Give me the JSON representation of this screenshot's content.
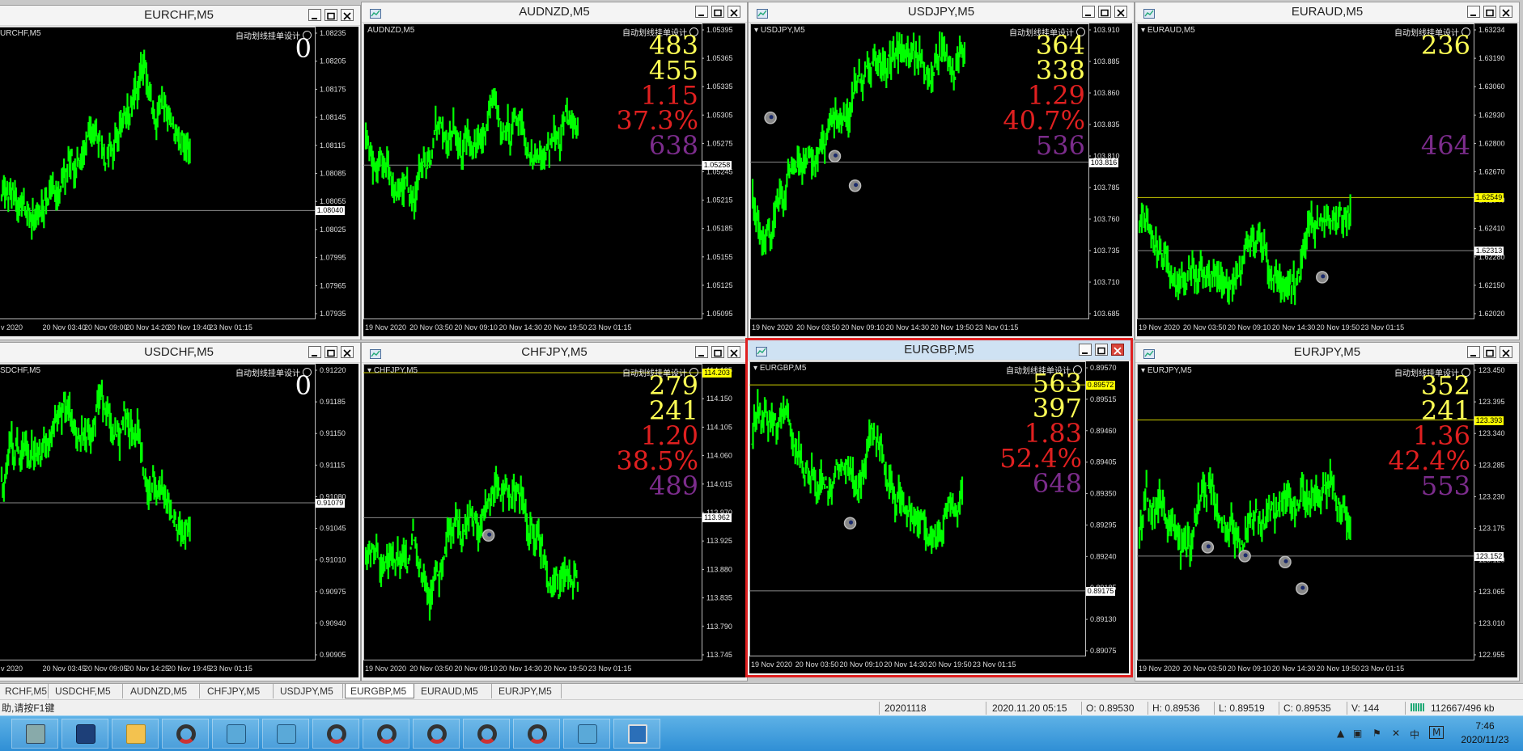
{
  "windows": [
    {
      "title": "EURCHF,M5",
      "label": "URCHF,M5",
      "ea": "自动划线挂单设计",
      "stats": [
        "0"
      ],
      "statColors": [
        "#ffffff"
      ],
      "ylabels": [
        "1.08235",
        "1.08205",
        "1.08175",
        "1.08145",
        "1.08115",
        "1.08085",
        "1.08055",
        "1.08025",
        "1.07995",
        "1.07965",
        "1.07935"
      ],
      "xlabels": [
        "v 2020",
        "20 Nov 03:40",
        "20 Nov 09:00",
        "20 Nov 14:20",
        "20 Nov 19:40",
        "23 Nov 01:15"
      ],
      "priceTags": [
        {
          "text": "1.08040",
          "color": "white"
        }
      ],
      "hasIcon": false,
      "active": false
    },
    {
      "title": "AUDNZD,M5",
      "label": "AUDNZD,M5",
      "ea": "自动划线挂单设计",
      "stats": [
        "483",
        "455",
        "1.15",
        "37.3%",
        "638"
      ],
      "statColors": [
        "#ffff55",
        "#ffff55",
        "#e02020",
        "#e02020",
        "#7c2c8c"
      ],
      "ylabels": [
        "1.05395",
        "1.05365",
        "1.05335",
        "1.05305",
        "1.05275",
        "1.05245",
        "1.05215",
        "1.05185",
        "1.05155",
        "1.05125",
        "1.05095"
      ],
      "xlabels": [
        "19 Nov 2020",
        "20 Nov 03:50",
        "20 Nov 09:10",
        "20 Nov 14:30",
        "20 Nov 19:50",
        "23 Nov 01:15"
      ],
      "priceTags": [
        {
          "text": "1.05258",
          "color": "white"
        }
      ],
      "hasIcon": true,
      "active": false
    },
    {
      "title": "USDJPY,M5",
      "label": "USDJPY,M5",
      "ea": "自动划线挂单设计",
      "stats": [
        "364",
        "338",
        "1.29",
        "40.7%",
        "536"
      ],
      "statColors": [
        "#ffff55",
        "#ffff55",
        "#e02020",
        "#e02020",
        "#7c2c8c"
      ],
      "ylabels": [
        "103.910",
        "103.885",
        "103.860",
        "103.835",
        "103.810",
        "103.785",
        "103.760",
        "103.735",
        "103.710",
        "103.685"
      ],
      "xlabels": [
        "19 Nov 2020",
        "20 Nov 03:50",
        "20 Nov 09:10",
        "20 Nov 14:30",
        "20 Nov 19:50",
        "23 Nov 01:15"
      ],
      "priceTags": [
        {
          "text": "103.816",
          "color": "white"
        }
      ],
      "hasIcon": true,
      "active": false
    },
    {
      "title": "EURAUD,M5",
      "label": "EURAUD,M5",
      "ea": "自动划线挂单设计",
      "stats": [
        "236",
        "",
        "",
        "",
        "464"
      ],
      "statColors": [
        "#ffff55",
        "#ffff55",
        "#e02020",
        "#e02020",
        "#7c2c8c"
      ],
      "ylabels": [
        "1.63234",
        "1.63190",
        "1.63060",
        "1.62930",
        "1.62800",
        "1.62670",
        "1.62540",
        "1.62410",
        "1.62280",
        "1.62150",
        "1.62020"
      ],
      "xlabels": [
        "19 Nov 2020",
        "20 Nov 03:50",
        "20 Nov 09:10",
        "20 Nov 14:30",
        "20 Nov 19:50",
        "23 Nov 01:15"
      ],
      "priceTags": [
        {
          "text": "1.62549",
          "color": "yellow"
        },
        {
          "text": "1.62313",
          "color": "white"
        }
      ],
      "hasIcon": true,
      "active": false
    },
    {
      "title": "USDCHF,M5",
      "label": "SDCHF,M5",
      "ea": "自动划线挂单设计",
      "stats": [
        "0"
      ],
      "statColors": [
        "#ffffff"
      ],
      "ylabels": [
        "0.91220",
        "0.91185",
        "0.91150",
        "0.91115",
        "0.91080",
        "0.91045",
        "0.91010",
        "0.90975",
        "0.90940",
        "0.90905"
      ],
      "xlabels": [
        "v 2020",
        "20 Nov 03:45",
        "20 Nov 09:05",
        "20 Nov 14:25",
        "20 Nov 19:45",
        "23 Nov 01:15"
      ],
      "priceTags": [
        {
          "text": "0.91079",
          "color": "white"
        }
      ],
      "hasIcon": false,
      "active": false
    },
    {
      "title": "CHFJPY,M5",
      "label": "CHFJPY,M5",
      "ea": "自动划线挂单设计",
      "stats": [
        "279",
        "241",
        "1.20",
        "38.5%",
        "489"
      ],
      "statColors": [
        "#ffff55",
        "#ffff55",
        "#e02020",
        "#e02020",
        "#7c2c8c"
      ],
      "ylabels": [
        "114.195",
        "114.150",
        "114.105",
        "114.060",
        "114.015",
        "113.970",
        "113.925",
        "113.880",
        "113.835",
        "113.790",
        "113.745"
      ],
      "xlabels": [
        "19 Nov 2020",
        "20 Nov 03:50",
        "20 Nov 09:10",
        "20 Nov 14:30",
        "20 Nov 19:50",
        "23 Nov 01:15"
      ],
      "priceTags": [
        {
          "text": "114.203",
          "color": "yellow"
        },
        {
          "text": "113.962",
          "color": "white"
        }
      ],
      "hasIcon": true,
      "active": false
    },
    {
      "title": "EURGBP,M5",
      "label": "EURGBP,M5",
      "ea": "自动划线挂单设计",
      "stats": [
        "563",
        "397",
        "1.83",
        "52.4%",
        "648"
      ],
      "statColors": [
        "#ffff55",
        "#ffff55",
        "#e02020",
        "#e02020",
        "#7c2c8c"
      ],
      "ylabels": [
        "0.89570",
        "0.89515",
        "0.89460",
        "0.89405",
        "0.89350",
        "0.89295",
        "0.89240",
        "0.89185",
        "0.89130",
        "0.89075"
      ],
      "xlabels": [
        "19 Nov 2020",
        "20 Nov 03:50",
        "20 Nov 09:10",
        "20 Nov 14:30",
        "20 Nov 19:50",
        "23 Nov 01:15"
      ],
      "priceTags": [
        {
          "text": "0.89572",
          "color": "yellow"
        },
        {
          "text": "0.89175",
          "color": "white"
        }
      ],
      "hasIcon": true,
      "active": true
    },
    {
      "title": "EURJPY,M5",
      "label": "EURJPY,M5",
      "ea": "自动划线挂单设计",
      "stats": [
        "352",
        "241",
        "1.36",
        "42.4%",
        "553"
      ],
      "statColors": [
        "#ffff55",
        "#ffff55",
        "#e02020",
        "#e02020",
        "#7c2c8c"
      ],
      "ylabels": [
        "123.450",
        "123.395",
        "123.340",
        "123.285",
        "123.230",
        "123.175",
        "123.120",
        "123.065",
        "123.010",
        "122.955"
      ],
      "xlabels": [
        "19 Nov 2020",
        "20 Nov 03:50",
        "20 Nov 09:10",
        "20 Nov 14:30",
        "20 Nov 19:50",
        "23 Nov 01:15"
      ],
      "priceTags": [
        {
          "text": "123.393",
          "color": "yellow"
        },
        {
          "text": "123.152",
          "color": "white"
        }
      ],
      "hasIcon": true,
      "active": false
    }
  ],
  "tabs": [
    "RCHF,M5",
    "USDCHF,M5",
    "AUDNZD,M5",
    "CHFJPY,M5",
    "USDJPY,M5",
    "EURGBP,M5",
    "EURAUD,M5",
    "EURJPY,M5"
  ],
  "activeTab": "EURGBP,M5",
  "status": {
    "help": "助,请按F1键",
    "date": "20201118",
    "datetime": "2020.11.20 05:15",
    "open": "O: 0.89530",
    "high": "H: 0.89536",
    "low": "L: 0.89519",
    "close": "C: 0.89535",
    "volume": "V: 144",
    "traffic": "112667/496 kb"
  },
  "taskbar": {
    "time": "7:46",
    "date": "2020/11/23",
    "ime": "中",
    "ime2": "M",
    "apps": [
      "server-manager-icon",
      "powershell-icon",
      "file-explorer-icon",
      "mt4-terminal-icon",
      "network-people-icon",
      "network-people-icon",
      "mt4-terminal-icon",
      "mt4-terminal-icon",
      "mt4-terminal-icon",
      "mt4-terminal-icon",
      "mt4-terminal-icon",
      "network-people-icon",
      "monitor-icon"
    ]
  },
  "colors": {
    "candle": "#00ff00",
    "accent": "#e02020",
    "yellow": "#ffff55",
    "purple": "#7c2c8c"
  }
}
